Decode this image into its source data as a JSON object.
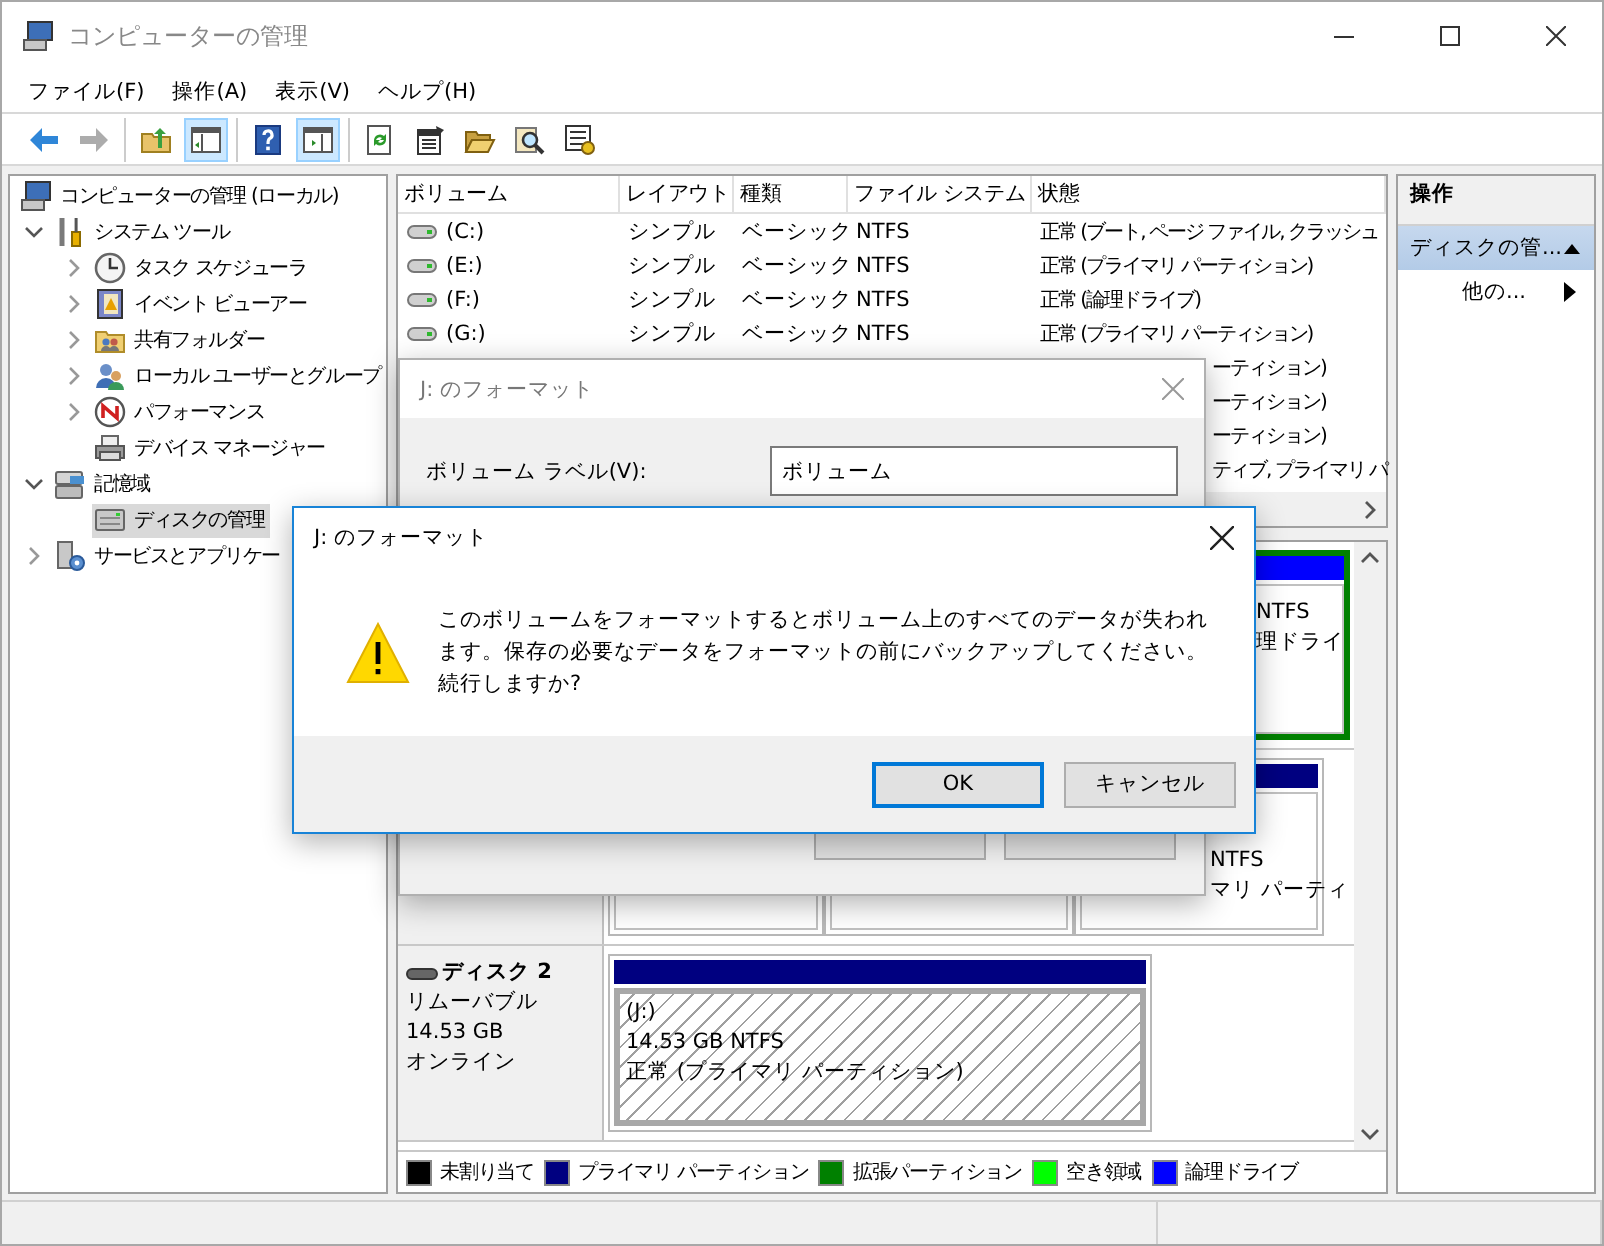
{
  "window": {
    "title": "コンピューターの管理"
  },
  "menu": [
    "ファイル(F)",
    "操作(A)",
    "表示(V)",
    "ヘルプ(H)"
  ],
  "toolbar": [
    [
      {
        "kind": "back",
        "pressed": false,
        "disabled": false
      },
      {
        "kind": "forward",
        "pressed": false,
        "disabled": true
      }
    ],
    [
      {
        "kind": "up",
        "pressed": false,
        "disabled": false
      },
      {
        "kind": "tree",
        "pressed": true,
        "disabled": false
      }
    ],
    [
      {
        "kind": "help",
        "pressed": false,
        "disabled": false
      },
      {
        "kind": "pane",
        "pressed": true,
        "disabled": false
      }
    ],
    [
      {
        "kind": "refresh",
        "pressed": false,
        "disabled": false
      },
      {
        "kind": "properties",
        "pressed": false,
        "disabled": false
      },
      {
        "kind": "open",
        "pressed": false,
        "disabled": false
      },
      {
        "kind": "search",
        "pressed": false,
        "disabled": false
      },
      {
        "kind": "options",
        "pressed": false,
        "disabled": false
      }
    ]
  ],
  "tree": [
    {
      "label": "コンピューターの管理 (ローカル)",
      "kind": "computer",
      "selected": false,
      "children": [
        {
          "label": "システム ツール",
          "kind": "tools",
          "expanded": true,
          "selected": false,
          "children": [
            {
              "label": "タスク スケジューラ",
              "kind": "clock",
              "expanded": false,
              "selected": false
            },
            {
              "label": "イベント ビューアー",
              "kind": "log",
              "expanded": false,
              "selected": false
            },
            {
              "label": "共有フォルダー",
              "kind": "share",
              "expanded": false,
              "selected": false
            },
            {
              "label": "ローカル ユーザーとグループ",
              "kind": "users",
              "expanded": false,
              "selected": false
            },
            {
              "label": "パフォーマンス",
              "kind": "gauge",
              "expanded": false,
              "selected": false
            },
            {
              "label": "デバイス マネージャー",
              "kind": "device",
              "selected": false
            }
          ]
        },
        {
          "label": "記憶域",
          "kind": "storage",
          "expanded": true,
          "selected": false,
          "children": [
            {
              "label": "ディスクの管理",
              "kind": "disk",
              "selected": true
            }
          ]
        },
        {
          "label": "サービスとアプリケー",
          "kind": "services",
          "expanded": false,
          "selected": false
        }
      ]
    }
  ],
  "volumes": {
    "columns": [
      "ボリューム",
      "レイアウト",
      "種類",
      "ファイル システム",
      "状態"
    ],
    "rows": [
      {
        "volume": "(C:)",
        "layout": "シンプル",
        "type": "ベーシック",
        "file_system": "NTFS",
        "status": "正常 (ブート, ページ ファイル, クラッシュ",
        "partly_hidden": false
      },
      {
        "volume": "(E:)",
        "layout": "シンプル",
        "type": "ベーシック",
        "file_system": "NTFS",
        "status": "正常 (プライマリ パーティション)",
        "partly_hidden": false
      },
      {
        "volume": "(F:)",
        "layout": "シンプル",
        "type": "ベーシック",
        "file_system": "NTFS",
        "status": "正常 (論理ドライブ)",
        "partly_hidden": false
      },
      {
        "volume": "(G:)",
        "layout": "シンプル",
        "type": "ベーシック",
        "file_system": "NTFS",
        "status": "正常 (プライマリ パーティション)",
        "partly_hidden": false
      },
      {
        "status": "ーティション)",
        "partly_hidden": true
      },
      {
        "status": "ーティション)",
        "partly_hidden": true
      },
      {
        "status": "ーティション)",
        "partly_hidden": true
      },
      {
        "status": "ティブ, プライマリ パ",
        "partly_hidden": true
      }
    ]
  },
  "disk_map": {
    "disks": [
      {
        "kind": "tail",
        "partitions": [
          {
            "kind": "logical",
            "selected": false,
            "lines": [
              "NTFS",
              "理ドライ"
            ]
          }
        ]
      },
      {
        "kind": "tail",
        "partitions": [
          {
            "kind": "primary",
            "selected": false
          },
          {
            "kind": "primary",
            "selected": false
          },
          {
            "kind": "primary",
            "selected": false,
            "lines": [
              "NTFS",
              "マリ パーティ"
            ]
          }
        ]
      },
      {
        "kind": "full",
        "name": "ディスク 2",
        "lines": [
          "リムーバブル",
          "14.53 GB",
          "オンライン"
        ],
        "partitions": [
          {
            "kind": "primary",
            "selected": true,
            "lines": [
              "(J:)",
              "14.53 GB NTFS",
              "正常 (プライマリ パーティション)"
            ]
          }
        ]
      }
    ]
  },
  "legend": [
    {
      "label": "未割り当て",
      "color": "#000000"
    },
    {
      "label": "プライマリ パーティション",
      "color": "#000080"
    },
    {
      "label": "拡張パーティション",
      "color": "#008000"
    },
    {
      "label": "空き領域",
      "color": "#00ff00"
    },
    {
      "label": "論理ドライブ",
      "color": "#0000ff"
    }
  ],
  "actions": {
    "title": "操作",
    "items": [
      {
        "label": "ディスクの管...",
        "kind": "section",
        "selected": true
      },
      {
        "label": "他の...",
        "kind": "submenu",
        "selected": false
      }
    ]
  },
  "format_dialog": {
    "title": "J: のフォーマット",
    "label": "ボリューム ラベル(V):",
    "value": "ボリューム"
  },
  "confirm_dialog": {
    "title": "J: のフォーマット",
    "message": "このボリュームをフォーマットするとボリューム上のすべてのデータが失われます。保存の必要なデータをフォーマットの前にバックアップしてください。続行しますか?",
    "buttons": [
      {
        "label": "OK",
        "default": true
      },
      {
        "label": "キャンセル",
        "default": false
      }
    ]
  }
}
